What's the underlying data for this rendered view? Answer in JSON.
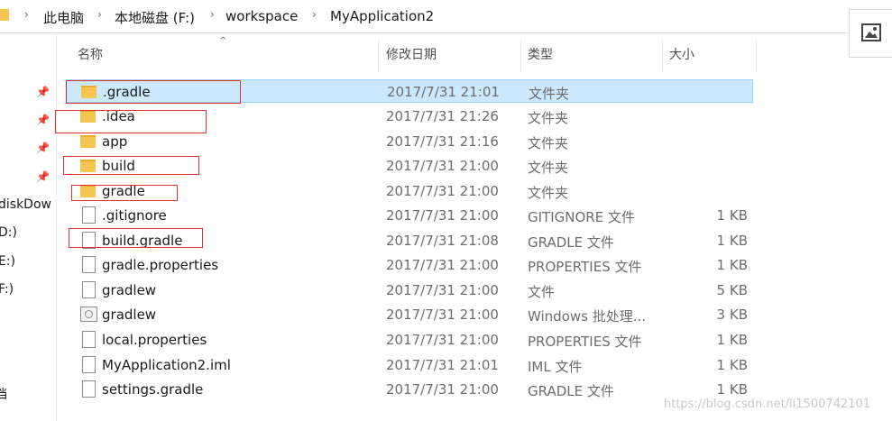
{
  "breadcrumb": {
    "items": [
      "此电脑",
      "本地磁盘 (F:)",
      "workspace",
      "MyApplication2"
    ]
  },
  "nav": {
    "items": [
      "diskDow",
      "D:)",
      "E:)",
      "F:)",
      "档"
    ]
  },
  "columns": {
    "name": "名称",
    "date": "修改日期",
    "type": "类型",
    "size": "大小"
  },
  "files": [
    {
      "name": ".gradle",
      "date": "2017/7/31 21:01",
      "type": "文件夹",
      "size": "",
      "icon": "folder-icon"
    },
    {
      "name": ".idea",
      "date": "2017/7/31 21:26",
      "type": "文件夹",
      "size": "",
      "icon": "folder-icon"
    },
    {
      "name": "app",
      "date": "2017/7/31 21:16",
      "type": "文件夹",
      "size": "",
      "icon": "folder-icon"
    },
    {
      "name": "build",
      "date": "2017/7/31 21:00",
      "type": "文件夹",
      "size": "",
      "icon": "folder-icon"
    },
    {
      "name": "gradle",
      "date": "2017/7/31 21:00",
      "type": "文件夹",
      "size": "",
      "icon": "folder-icon"
    },
    {
      "name": ".gitignore",
      "date": "2017/7/31 21:00",
      "type": "GITIGNORE 文件",
      "size": "1 KB",
      "icon": "file-icon"
    },
    {
      "name": "build.gradle",
      "date": "2017/7/31 21:08",
      "type": "GRADLE 文件",
      "size": "1 KB",
      "icon": "file-icon"
    },
    {
      "name": "gradle.properties",
      "date": "2017/7/31 21:00",
      "type": "PROPERTIES 文件",
      "size": "1 KB",
      "icon": "file-icon"
    },
    {
      "name": "gradlew",
      "date": "2017/7/31 21:00",
      "type": "文件",
      "size": "5 KB",
      "icon": "file-icon"
    },
    {
      "name": "gradlew",
      "date": "2017/7/31 21:00",
      "type": "Windows 批处理...",
      "size": "3 KB",
      "icon": "batch-file-icon"
    },
    {
      "name": "local.properties",
      "date": "2017/7/31 21:00",
      "type": "PROPERTIES 文件",
      "size": "1 KB",
      "icon": "file-icon"
    },
    {
      "name": "MyApplication2.iml",
      "date": "2017/7/31 21:01",
      "type": "IML 文件",
      "size": "1 KB",
      "icon": "file-icon"
    },
    {
      "name": "settings.gradle",
      "date": "2017/7/31 21:00",
      "type": "GRADLE 文件",
      "size": "1 KB",
      "icon": "file-icon"
    }
  ],
  "watermark": "https://blog.csdn.net/li1500742101",
  "colors": {
    "selection": "#cce8ff",
    "highlight_box": "#e03030",
    "folder": "#f5c451"
  }
}
